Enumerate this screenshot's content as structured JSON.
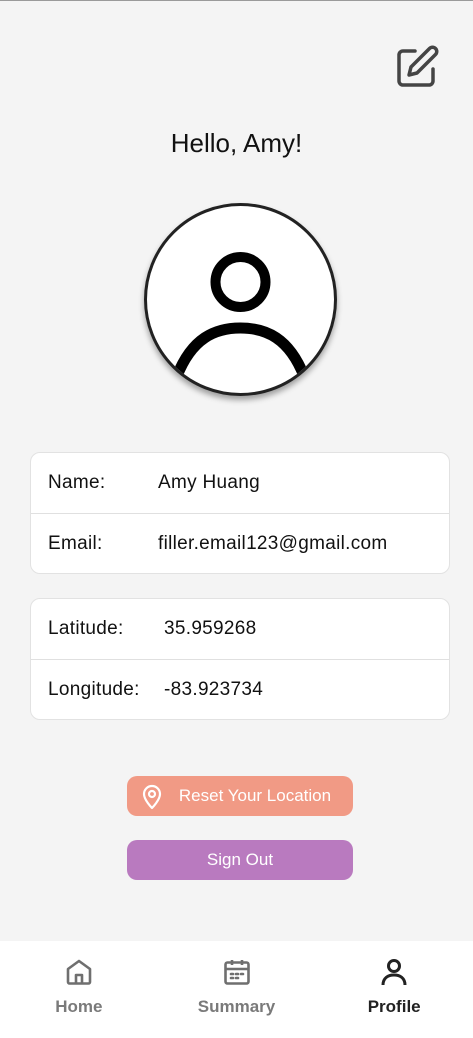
{
  "header": {
    "greeting": "Hello, Amy!",
    "edit_icon": "edit-square-icon"
  },
  "avatar": {
    "icon": "person-avatar-icon"
  },
  "profile_card": {
    "rows": [
      {
        "label": "Name:",
        "value": "Amy Huang"
      },
      {
        "label": "Email:",
        "value": "filler.email123@gmail.com"
      }
    ]
  },
  "location_card": {
    "rows": [
      {
        "label": "Latitude:",
        "value": "35.959268"
      },
      {
        "label": "Longitude:",
        "value": "-83.923734"
      }
    ]
  },
  "actions": {
    "reset_location_label": "Reset Your Location",
    "reset_location_icon": "map-pin-icon",
    "sign_out_label": "Sign Out"
  },
  "bottom_nav": {
    "items": [
      {
        "label": "Home",
        "icon": "home-icon",
        "active": false
      },
      {
        "label": "Summary",
        "icon": "calendar-icon",
        "active": false
      },
      {
        "label": "Profile",
        "icon": "person-icon",
        "active": true
      }
    ]
  },
  "colors": {
    "background": "#f4f4f4",
    "reset_button": "#f19a85",
    "sign_out_button": "#b97abf",
    "nav_inactive": "#7a7a7a",
    "nav_active": "#222222"
  }
}
